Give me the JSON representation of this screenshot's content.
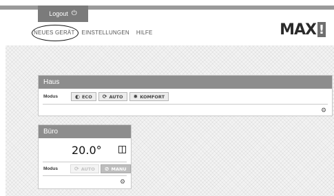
{
  "header": {
    "logout_label": "Logout",
    "logout_icon": "power-icon",
    "nav": [
      "NEUES GERÄT",
      "EINSTELLUNGEN",
      "HILFE"
    ],
    "logo_text": "MAX",
    "logo_mark": "!"
  },
  "rooms": {
    "haus": {
      "title": "Haus",
      "modus_label": "Modus",
      "buttons": [
        {
          "label": "ECO",
          "icon": "half-moon-icon"
        },
        {
          "label": "AUTO",
          "icon": "auto-cycle-icon"
        },
        {
          "label": "KOMFORT",
          "icon": "sun-icon"
        }
      ]
    },
    "buero": {
      "title": "Büro",
      "temperature": "20.0°",
      "modus_label": "Modus",
      "buttons": [
        {
          "label": "AUTO",
          "icon": "auto-cycle-icon",
          "state": "disabled"
        },
        {
          "label": "MANU",
          "icon": "manual-icon",
          "state": "active"
        }
      ]
    }
  },
  "colors": {
    "header_bar": "#9a9a9a",
    "logout_bg": "#7b7b7b",
    "panel_header": "#8d8d8d"
  }
}
